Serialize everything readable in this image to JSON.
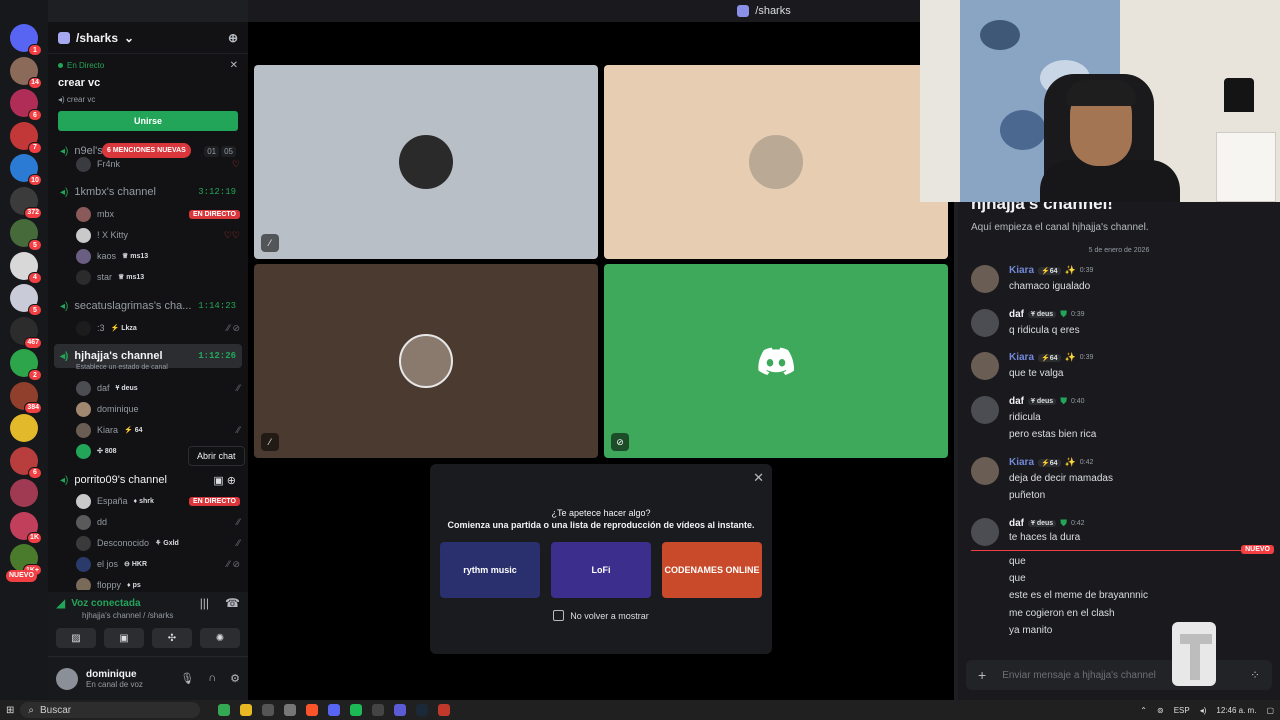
{
  "window_title": "/sharks",
  "servers": [
    {
      "badge": "1",
      "color": "#5865f2"
    },
    {
      "badge": "14",
      "color": "#8b6a5a"
    },
    {
      "badge": "6",
      "color": "#b02d57"
    },
    {
      "badge": "7",
      "color": "#c23838"
    },
    {
      "badge": "10",
      "color": "#2b7bd4"
    },
    {
      "badge": "372",
      "color": "#3b3b3b"
    },
    {
      "badge": "5",
      "color": "#466a3a"
    },
    {
      "badge": "4",
      "color": "#d8d8d8"
    },
    {
      "badge": "5",
      "color": "#c9ccd8"
    },
    {
      "badge": "467",
      "color": "#2c2c2c"
    },
    {
      "badge": "2",
      "color": "#2da54a"
    },
    {
      "badge": "384",
      "color": "#8f3f2c"
    },
    {
      "badge": "",
      "color": "#e2b92a"
    },
    {
      "badge": "6",
      "color": "#b83d3d"
    },
    {
      "badge": "",
      "color": "#a03a52"
    },
    {
      "badge": "1K",
      "color": "#c23f5c"
    },
    {
      "badge": "1K+",
      "color": "#4a7b2c"
    }
  ],
  "servers_new_label": "NUEVO",
  "guild": {
    "name": "/sharks"
  },
  "live_event": {
    "status": "En Directo",
    "title": "crear vc",
    "sub": "crear vc",
    "join": "Unirse"
  },
  "mentions_pill": "6 MENCIONES NUEVAS",
  "channels": {
    "c1": {
      "name": "n9el's channel",
      "counts": [
        "01",
        "05"
      ]
    },
    "c2": {
      "name": "1kmbx's channel",
      "timer": "3:12:19"
    },
    "c3": {
      "name": "secatuslagrimas's cha...",
      "timer": "1:14:23"
    },
    "c4": {
      "name": "hjhajja's channel",
      "timer": "1:12:26",
      "status": "Establece un estado de canal"
    },
    "c5": {
      "name": "porrito09's channel"
    }
  },
  "users": {
    "fr4nk": "Fr4nk",
    "mbx": "mbx",
    "kitty": "! X Kitty",
    "kaos": "kaos",
    "kaos_tag": "ms13",
    "star": "star",
    "star_tag": "ms13",
    "lkza_pre": ":3",
    "lkza_tag": "Lkza",
    "daf": "daf",
    "daf_tag": "deus",
    "dominique": "dominique",
    "kiara": "Kiara",
    "kiara_tag": "64",
    "u808_tag": "808",
    "espana": "España",
    "espana_tag": "shrk",
    "dd": "dd",
    "desconocido": "Desconocido",
    "desconocido_tag": "Gxld",
    "eljos": "el jos",
    "eljos_tag": "HKR",
    "floppy": "floppy",
    "floppy_tag": "ps"
  },
  "live_label": "EN DIRECTO",
  "tooltip": "Abrir chat",
  "voice": {
    "title": "Voz conectada",
    "sub": "hjhajja's channel / /sharks"
  },
  "user_panel": {
    "name": "dominique",
    "status": "En canal de voz"
  },
  "activity": {
    "question": "¿Te apetece hacer algo?",
    "subtitle": "Comienza una partida o una lista de reproducción de vídeos al instante.",
    "cards": [
      {
        "label": "rythm music",
        "color": "#2a2f6e"
      },
      {
        "label": "LoFi",
        "color": "#3c2e8c"
      },
      {
        "label": "CODENAMES ONLINE",
        "color": "#c84a2a"
      }
    ],
    "checkbox": "No volver a mostrar"
  },
  "chat": {
    "title": "hjhajja's channel!",
    "intro": "Aquí empieza el canal hjhajja's channel.",
    "date": "5 de enero de 2026",
    "new_label": "NUEVO",
    "messages": [
      {
        "author": "Kiara",
        "tag": "64",
        "time": "0:39",
        "color": "#7289da",
        "lines": [
          "chamaco igualado"
        ]
      },
      {
        "author": "daf",
        "tag": "deus",
        "time": "0:39",
        "color": "#f2f3f5",
        "lines": [
          "q ridicula q eres"
        ]
      },
      {
        "author": "Kiara",
        "tag": "64",
        "time": "0:39",
        "color": "#7289da",
        "lines": [
          "que te valga"
        ]
      },
      {
        "author": "daf",
        "tag": "deus",
        "time": "0:40",
        "color": "#f2f3f5",
        "lines": [
          "ridicula",
          "pero estas bien rica"
        ]
      },
      {
        "author": "Kiara",
        "tag": "64",
        "time": "0:42",
        "color": "#7289da",
        "lines": [
          "deja de decir mamadas",
          "puñeton"
        ]
      },
      {
        "author": "daf",
        "tag": "deus",
        "time": "0:42",
        "color": "#f2f3f5",
        "lines": [
          "te haces la dura"
        ]
      }
    ],
    "after_new": [
      "que",
      "que",
      "este es el meme de brayannnic",
      "me cogieron en el clash",
      "ya manito"
    ],
    "composer_placeholder": "Enviar mensaje a hjhajja's channel"
  },
  "taskbar": {
    "search": "Buscar",
    "lang": "ESP",
    "time": "12:46 a. m."
  }
}
